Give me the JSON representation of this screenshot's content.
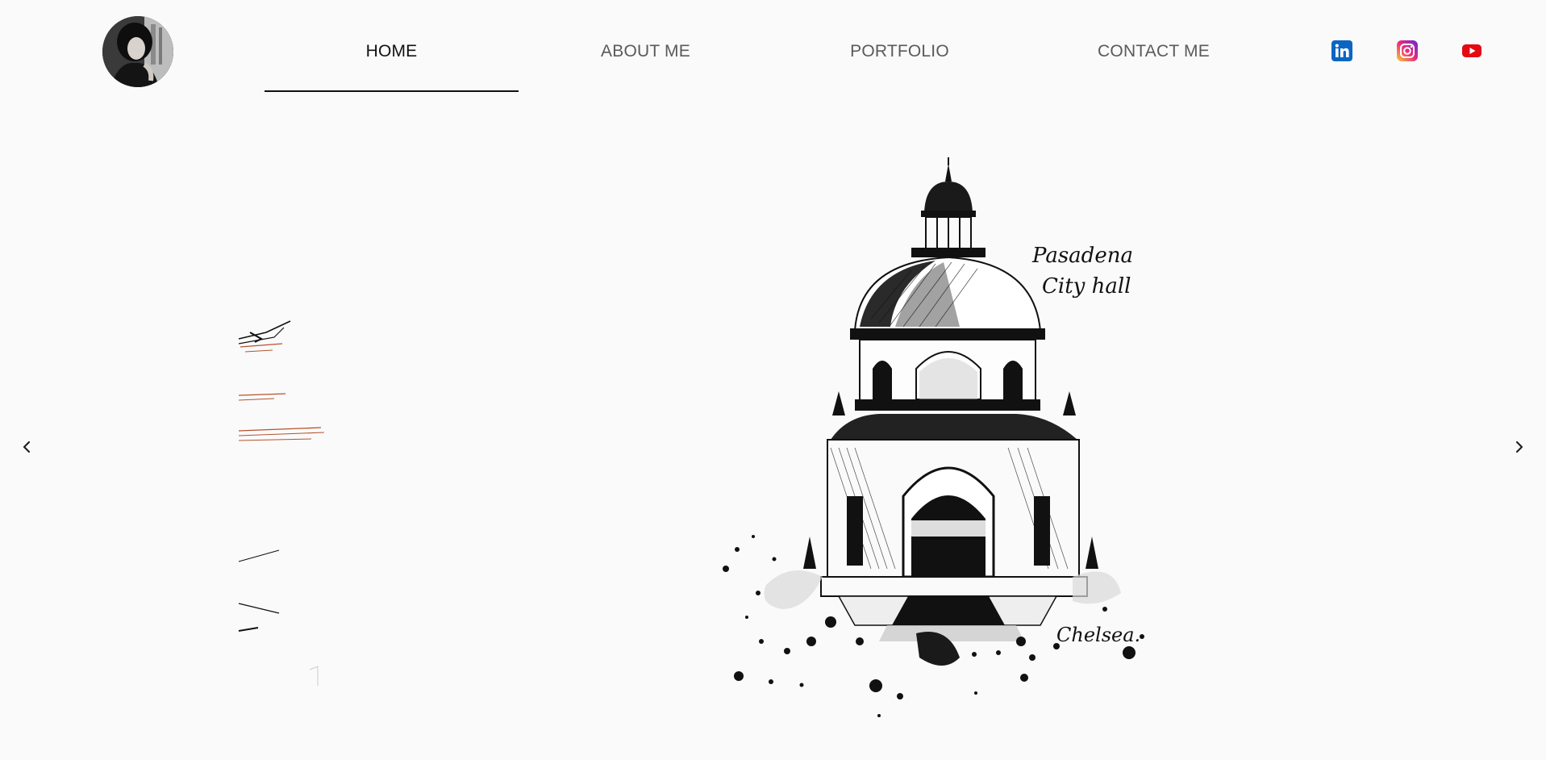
{
  "header": {
    "avatar_alt": "profile photo",
    "nav": [
      {
        "label": "HOME",
        "active": true
      },
      {
        "label": "ABOUT ME",
        "active": false
      },
      {
        "label": "PORTFOLIO",
        "active": false
      },
      {
        "label": "CONTACT ME",
        "active": false
      }
    ],
    "social": [
      {
        "name": "linkedin-icon",
        "color": "#0a66c2"
      },
      {
        "name": "instagram-icon",
        "color": "#e4405f"
      },
      {
        "name": "youtube-icon",
        "color": "#e50914"
      }
    ]
  },
  "carousel": {
    "prev_icon": "chevron-left-icon",
    "next_icon": "chevron-right-icon",
    "artwork_text": {
      "line1": "Pasadena",
      "line2": "City hall",
      "signature": "Chelsea."
    }
  },
  "colors": {
    "background": "#fafafa",
    "ink": "#111111",
    "accent_sketch": "#b5532d"
  }
}
